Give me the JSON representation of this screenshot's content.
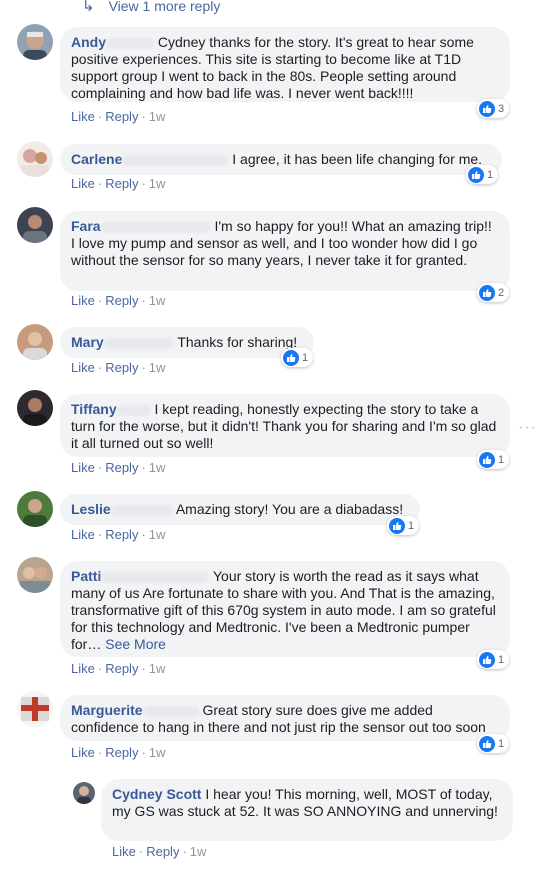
{
  "view_more": {
    "label": "View 1 more reply"
  },
  "action_labels": {
    "like": "Like",
    "reply": "Reply",
    "sep": "·"
  },
  "more_options_glyph": "···",
  "comments": [
    {
      "first_name": "Andy",
      "text": "Cydney thanks for the story. It's great to hear some positive experiences. This site is starting to become like at T1D support group I went to back in the 80s. People setting around complaining and how bad life was. I never went back!!!!",
      "likes": "3",
      "time": "1w"
    },
    {
      "first_name": "Carlene",
      "text": "I agree, it has been life changing for me.",
      "likes": "1",
      "time": "1w"
    },
    {
      "first_name": "Fara",
      "text": "I'm so happy for you!! What an amazing trip!! I love my pump and sensor as well, and I too wonder how did I go without the sensor for so many years, I never take it for granted.",
      "likes": "2",
      "time": "1w"
    },
    {
      "first_name": "Mary",
      "text": "Thanks for sharing!",
      "likes": "1",
      "time": "1w"
    },
    {
      "first_name": "Tiffany",
      "text": "I kept reading, honestly expecting the story to take a turn for the worse, but it didn't! Thank you for sharing and I'm so glad it all turned out so well!",
      "likes": "1",
      "time": "1w"
    },
    {
      "first_name": "Leslie",
      "text": "Amazing story! You are a diabadass!",
      "likes": "1",
      "time": "1w"
    },
    {
      "first_name": "Patti",
      "text": "Your story is worth the read as it says what many of us Are fortunate to share with you. And That is the amazing, transformative gift of this 670g system in auto mode. I am so grateful for this technology and Medtronic. I've been a Medtronic pumper for…",
      "see_more": "See More",
      "likes": "1",
      "time": "1w"
    },
    {
      "first_name": "Marguerite",
      "text": "Great story sure does give me added confidence to hang in there and not just rip the sensor out too soon",
      "likes": "1",
      "time": "1w"
    }
  ],
  "reply": {
    "author": "Cydney Scott",
    "text": "I hear you! This morning, well, MOST of today, my GS was stuck at 52. It was SO ANNOYING and unnerving!",
    "time": "1w"
  },
  "colors": {
    "link": "#385898",
    "bubble": "#f2f3f5",
    "like_blue": "#1877f2",
    "meta": "#90949c"
  },
  "icons": {
    "reply_arrow": "reply-arrow-icon",
    "like": "thumbs-up-icon"
  }
}
